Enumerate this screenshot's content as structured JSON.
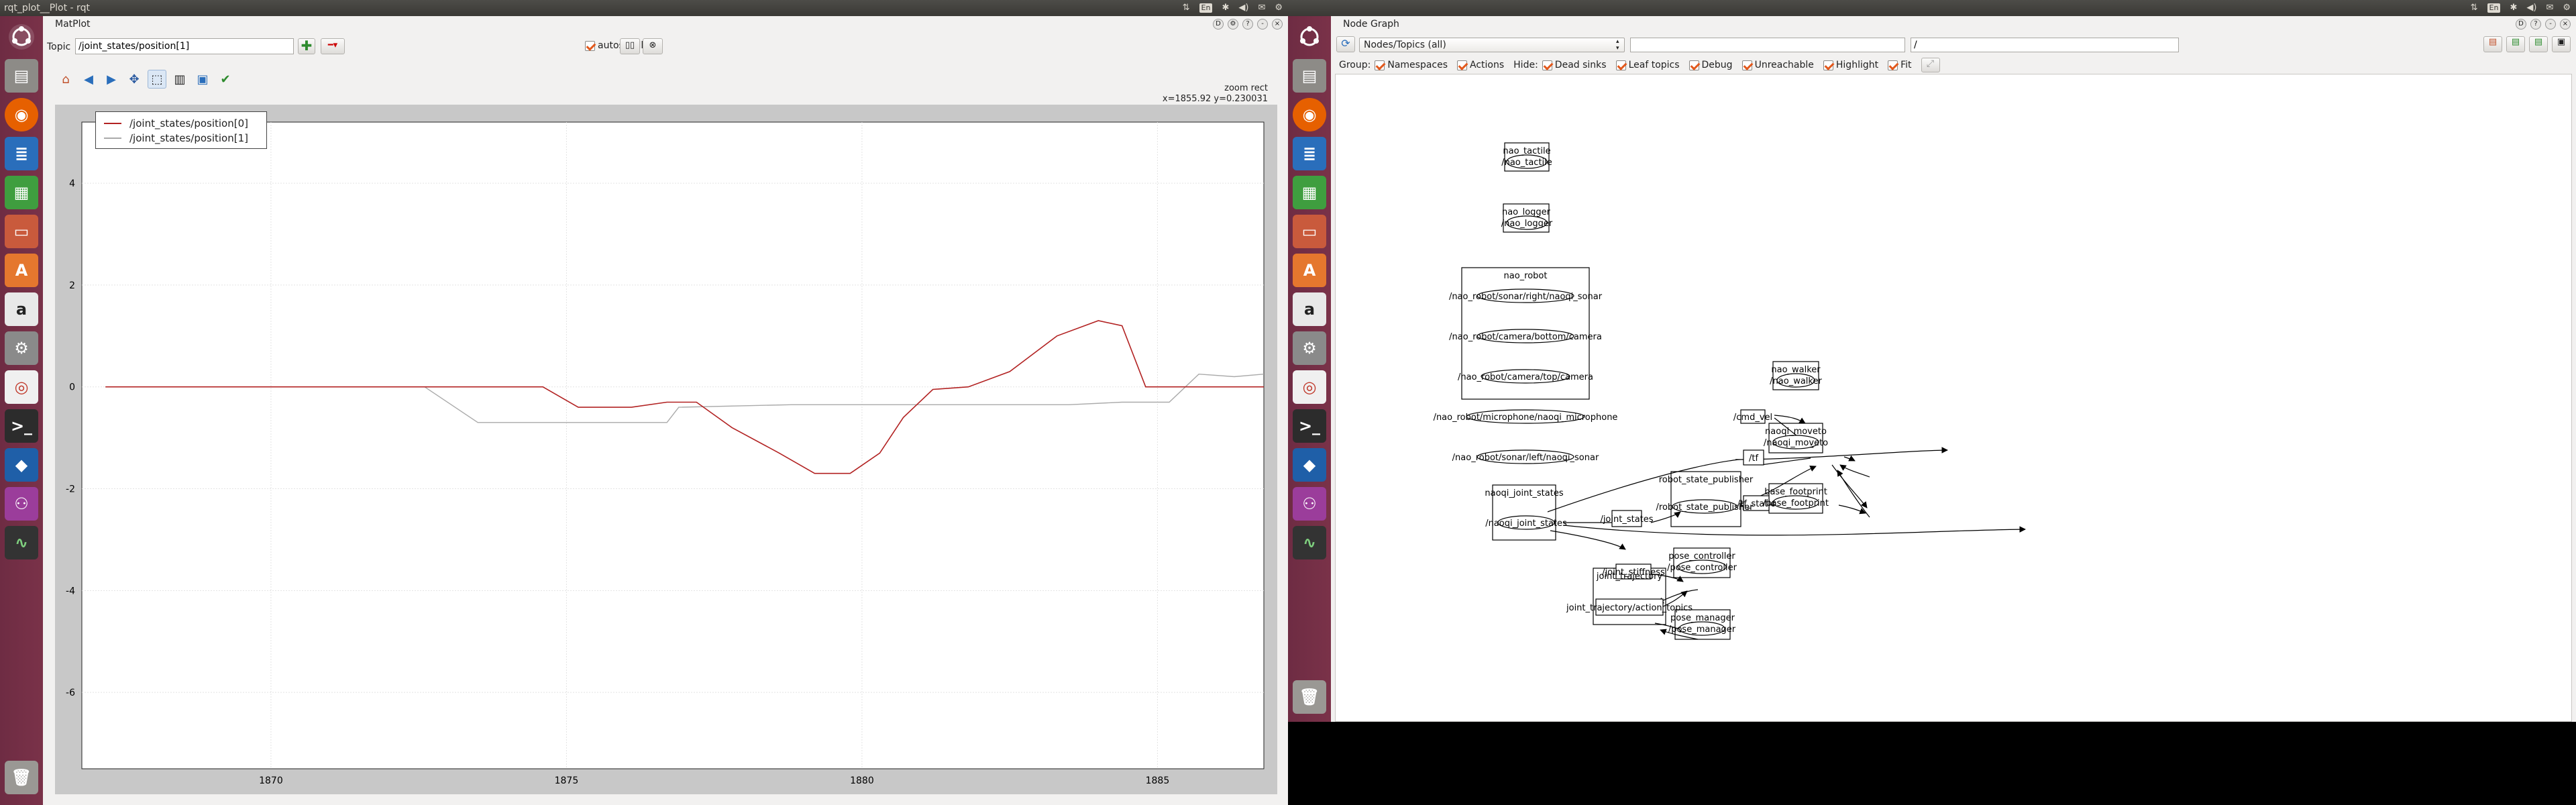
{
  "left": {
    "window_title": "rqt_plot__Plot - rqt",
    "plugin_title": "MatPlot",
    "topic_label": "Topic",
    "topic_value": "/joint_states/position[1]",
    "autoscroll_label": "autoscroll",
    "zoom_mode": "zoom rect",
    "coords": "x=1855.92    y=0.230031",
    "legend": [
      "/joint_states/position[0]",
      "/joint_states/position[1]"
    ]
  },
  "chart_data": {
    "type": "line",
    "xlim": [
      1867.2,
      1887.8
    ],
    "ylim": [
      -7.5,
      5.2
    ],
    "x_ticks": [
      1870,
      1875,
      1880,
      1885
    ],
    "y_ticks": [
      4,
      2,
      0,
      -2,
      -4,
      -6
    ],
    "grid": true,
    "legend_position": "top-left",
    "series": [
      {
        "name": "/joint_states/position[0]",
        "color": "#b22222",
        "points": [
          [
            1867.2,
            0
          ],
          [
            1871.5,
            0
          ],
          [
            1874.6,
            0
          ],
          [
            1875.2,
            -0.4
          ],
          [
            1876.1,
            -0.4
          ],
          [
            1876.7,
            -0.3
          ],
          [
            1877.2,
            -0.3
          ],
          [
            1877.8,
            -0.8
          ],
          [
            1878.6,
            -1.3
          ],
          [
            1879.2,
            -1.7
          ],
          [
            1879.8,
            -1.7
          ],
          [
            1880.3,
            -1.3
          ],
          [
            1880.7,
            -0.6
          ],
          [
            1881.2,
            -0.05
          ],
          [
            1881.8,
            0
          ],
          [
            1882.5,
            0.3
          ],
          [
            1883.3,
            1.0
          ],
          [
            1884.0,
            1.3
          ],
          [
            1884.4,
            1.2
          ],
          [
            1884.8,
            0
          ],
          [
            1887.8,
            0
          ]
        ]
      },
      {
        "name": "/joint_states/position[1]",
        "color": "#aaaaaa",
        "points": [
          [
            1867.2,
            0
          ],
          [
            1872.6,
            0
          ],
          [
            1873.5,
            -0.7
          ],
          [
            1875.3,
            -0.7
          ],
          [
            1876.7,
            -0.7
          ],
          [
            1876.9,
            -0.4
          ],
          [
            1878.8,
            -0.35
          ],
          [
            1881.2,
            -0.35
          ],
          [
            1883.5,
            -0.35
          ],
          [
            1884.4,
            -0.3
          ],
          [
            1885.2,
            -0.3
          ],
          [
            1885.7,
            0.25
          ],
          [
            1886.3,
            0.2
          ],
          [
            1887.3,
            0.2
          ],
          [
            1887.8,
            0.2
          ]
        ]
      }
    ],
    "extra_series_note": ""
  },
  "chart_view": {
    "x_visible": [
      1866.8,
      1886.8
    ],
    "y_visible": [
      -7.5,
      5.2
    ],
    "s0_tail": [
      [
        1886.8,
        0
      ]
    ],
    "s1_tail": [
      [
        1886.8,
        0.25
      ]
    ]
  },
  "right": {
    "plugin_title": "Node Graph",
    "mode_select": "Nodes/Topics (all)",
    "ns_filter": "/",
    "group_label": "Group:",
    "hide_label": "Hide:",
    "group_options": [
      "Namespaces",
      "Actions"
    ],
    "hide_options": [
      "Dead sinks",
      "Leaf topics",
      "Debug",
      "Unreachable",
      "Highlight",
      "Fit"
    ],
    "clusters": {
      "nao_tactile": "nao_tactile",
      "nao_logger": "nao_logger",
      "nao_robot": "nao_robot",
      "naoqi_joint_states": "naoqi_joint_states",
      "robot_state_publisher": "robot_state_publisher",
      "nao_walker": "nao_walker",
      "naoqi_moveto": "naoqi_moveto",
      "base_footprint": "base_footprint",
      "pose_controller": "pose_controller",
      "joint_trajectory": "joint_trajectory",
      "pose_manager": "pose_manager"
    },
    "nodes": {
      "nao_tactile": "/nao_tactile",
      "nao_logger": "/nao_logger",
      "sonar_right": "/nao_robot/sonar/right/naoqi_sonar",
      "camera_bottom": "/nao_robot/camera/bottom/camera",
      "camera_top": "/nao_robot/camera/top/camera",
      "microphone": "/nao_robot/microphone/naoqi_microphone",
      "sonar_left": "/nao_robot/sonar/left/naoqi_sonar",
      "naoqi_joint_states": "/naoqi_joint_states",
      "robot_state_publisher": "/robot_state_publisher",
      "nao_walker": "/nao_walker",
      "naoqi_moveto": "/naoqi_moveto",
      "base_footprint": "/base_footprint",
      "pose_controller": "/pose_controller",
      "pose_manager": "/pose_manager"
    },
    "topics": {
      "cmd_vel": "/cmd_vel",
      "tf": "/tf",
      "tf_static": "/tf_static",
      "joint_states": "/joint_states",
      "joint_stiffness": "/joint_stiffness",
      "action_topics": "joint_trajectory/action_topics"
    }
  }
}
